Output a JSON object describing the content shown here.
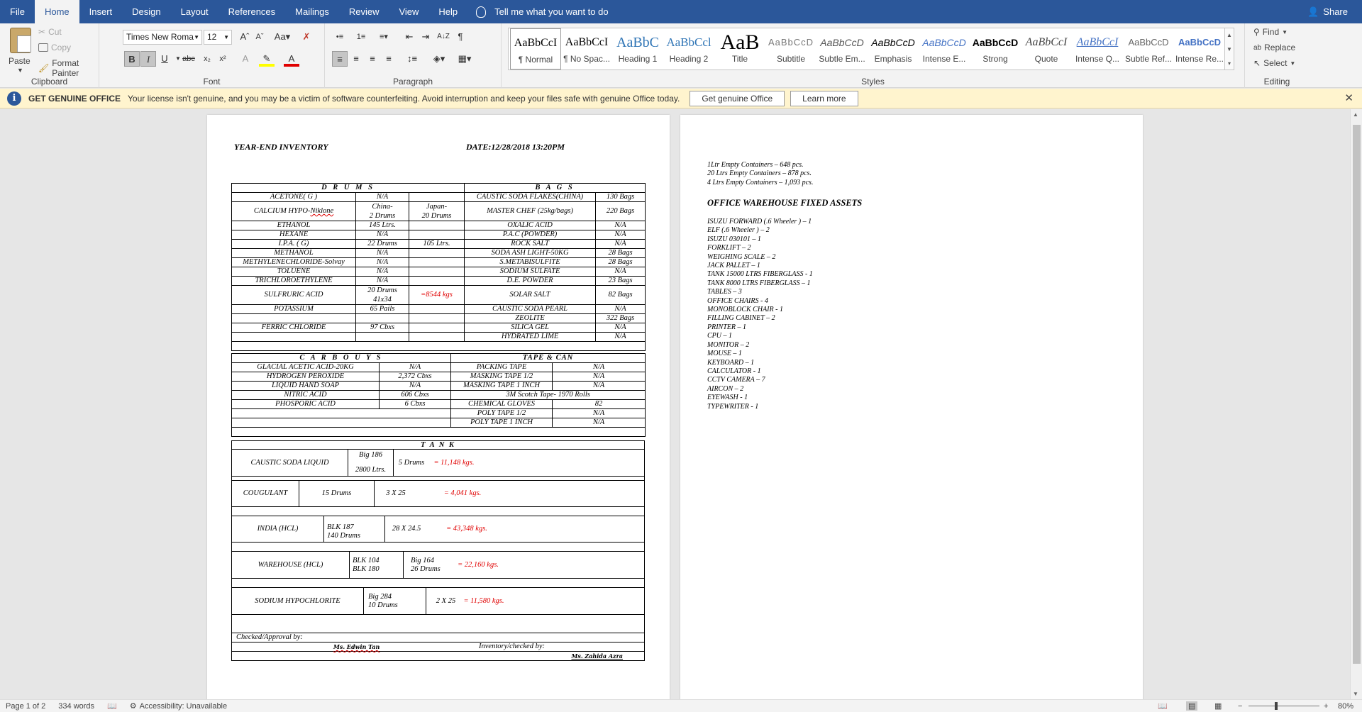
{
  "ribbon_tabs": [
    "File",
    "Home",
    "Insert",
    "Design",
    "Layout",
    "References",
    "Mailings",
    "Review",
    "View",
    "Help"
  ],
  "tell_me": "Tell me what you want to do",
  "share": "Share",
  "clipboard": {
    "paste": "Paste",
    "cut": "Cut",
    "copy": "Copy",
    "format_painter": "Format Painter",
    "label": "Clipboard"
  },
  "font": {
    "name": "Times New Roma",
    "size": "12",
    "label": "Font"
  },
  "paragraph": {
    "label": "Paragraph"
  },
  "styles": {
    "label": "Styles",
    "items": [
      {
        "sample": "AaBbCcI",
        "name": "¶ Normal"
      },
      {
        "sample": "AaBbCcI",
        "name": "¶ No Spac..."
      },
      {
        "sample": "AaBbC",
        "name": "Heading 1"
      },
      {
        "sample": "AaBbCcl",
        "name": "Heading 2"
      },
      {
        "sample": "AaB",
        "name": "Title"
      },
      {
        "sample": "AaBbCcD",
        "name": "Subtitle"
      },
      {
        "sample": "AaBbCcD",
        "name": "Subtle Em..."
      },
      {
        "sample": "AaBbCcD",
        "name": "Emphasis"
      },
      {
        "sample": "AaBbCcD",
        "name": "Intense E..."
      },
      {
        "sample": "AaBbCcD",
        "name": "Strong"
      },
      {
        "sample": "AaBbCcI",
        "name": "Quote"
      },
      {
        "sample": "AaBbCcI",
        "name": "Intense Q..."
      },
      {
        "sample": "AaBbCcD",
        "name": "Subtle Ref..."
      },
      {
        "sample": "AaBbCcD",
        "name": "Intense Re..."
      }
    ]
  },
  "editing": {
    "find": "Find",
    "replace": "Replace",
    "select": "Select",
    "label": "Editing"
  },
  "message_bar": {
    "title": "GET GENUINE OFFICE",
    "text": "Your license isn't genuine, and you may be a victim of software counterfeiting. Avoid interruption and keep your files safe with genuine Office today.",
    "btn1": "Get genuine Office",
    "btn2": "Learn more"
  },
  "doc": {
    "title": "YEAR-END INVENTORY",
    "date": "DATE:12/28/2018 13:20PM",
    "drums_header": "D R U M S",
    "bags_header": "B A G S",
    "drums_rows": [
      [
        "ACETONE( G )",
        "N/A",
        ""
      ],
      [
        "CALCIUM HYPO-Niklone",
        "China-\n2 Drums",
        "Japan-\n20 Drums"
      ],
      [
        "ETHANOL",
        "145 Ltrs.",
        ""
      ],
      [
        "HEXANE",
        "N/A",
        ""
      ],
      [
        "I.P.A. ( G)",
        "22 Drums",
        "105 Ltrs."
      ],
      [
        "METHANOL",
        "N/A",
        ""
      ],
      [
        "METHYLENECHLORIDE-Solvay",
        "N/A",
        ""
      ],
      [
        "TOLUENE",
        "N/A",
        ""
      ],
      [
        "TRICHLOROETHYLENE",
        "N/A",
        ""
      ],
      [
        "SULFRURIC ACID",
        "20 Drums\n41x34",
        "=8544 kgs"
      ],
      [
        "POTASSIUM",
        "65 Pails",
        ""
      ],
      [
        "",
        "",
        ""
      ],
      [
        "FERRIC CHLORIDE",
        "97 Cbxs",
        ""
      ],
      [
        "",
        "",
        ""
      ]
    ],
    "bags_rows": [
      [
        "CAUSTIC SODA FLAKES(CHINA)",
        "130  Bags"
      ],
      [
        "MASTER CHEF (25kg/bags)",
        "220 Bags"
      ],
      [
        "OXALIC ACID",
        "N/A"
      ],
      [
        "P.A.C (POWDER)",
        "N/A"
      ],
      [
        "ROCK SALT",
        "N/A"
      ],
      [
        "SODA ASH LIGHT-50KG",
        "28 Bags"
      ],
      [
        "S.METABISULFITE",
        "28 Bags"
      ],
      [
        "SODIUM SULFATE",
        "N/A"
      ],
      [
        "D.E. POWDER",
        "23 Bags"
      ],
      [
        "SOLAR SALT",
        "82 Bags"
      ],
      [
        "CAUSTIC SODA PEARL",
        "N/A"
      ],
      [
        "ZEOLITE",
        "322 Bags"
      ],
      [
        "SILICA GEL",
        "N/A"
      ],
      [
        "HYDRATED LIME",
        "N/A"
      ]
    ],
    "carbouys_header": "C A R B O U Y S",
    "tape_header": "TAPE  &  CAN",
    "carbouys_rows": [
      [
        "GLACIAL ACETIC ACID-20KG",
        "N/A"
      ],
      [
        "HYDROGEN PEROXIDE",
        "2,372 Cbxs"
      ],
      [
        "LIQUID HAND SOAP",
        "N/A"
      ],
      [
        "NITRIC ACID",
        "606 Cbxs"
      ],
      [
        "PHOSPORIC ACID",
        "6 Cbxs"
      ],
      [
        "",
        ""
      ],
      [
        "",
        ""
      ]
    ],
    "tape_rows": [
      [
        "PACKING TAPE",
        "N/A"
      ],
      [
        "MASKING TAPE 1/2",
        "N/A"
      ],
      [
        "MASKING TAPE 1 INCH",
        "N/A"
      ],
      [
        "3M Scotch Tape- 1970 Rolls",
        ""
      ],
      [
        "CHEMICAL GLOVES",
        "82"
      ],
      [
        "POLY TAPE 1/2",
        "N/A"
      ],
      [
        "POLY TAPE 1 INCH",
        "N/A"
      ]
    ],
    "tank_header": "T  A  N  K",
    "tank": {
      "caustic": {
        "name": "CAUSTIC SODA LIQUID",
        "a1": "Big 186",
        "a2": "2800 Ltrs.",
        "b": "5 Drums",
        "total": "= 11,148 kgs."
      },
      "cougulant": {
        "name": "COUGULANT",
        "a": "15 Drums",
        "b": "3 X 25",
        "total": "= 4,041 kgs."
      },
      "india": {
        "name": "INDIA (HCL)",
        "a1": "BLK  187",
        "a2": "140 Drums",
        "b": "28 X 24.5",
        "total": "= 43,348 kgs."
      },
      "warehouse": {
        "name": "WAREHOUSE (HCL)",
        "a1": "BLK 104",
        "a2": "BLK 180",
        "b1": "Big 164",
        "b2": "26 Drums",
        "total": "= 22,160 kgs."
      },
      "sodium": {
        "name": "SODIUM HYPOCHLORITE",
        "a1": "Big 284",
        "a2": "10 Drums",
        "b": "2 X 25",
        "total": "= 11,580 kgs."
      }
    },
    "checked": "Checked/Approval by:",
    "signer1": "Ms. Edwin Tan",
    "inventory_checked": "Inventory/checked   by:",
    "signer2": "Ms. Zahida Azra",
    "page2_lines": [
      "1Ltr Empty Containers – 648 pcs.",
      "20 Ltrs Empty Containers – 878 pcs.",
      "4 Ltrs Empty Containers – 1,093 pcs."
    ],
    "fixed_assets_title": "OFFICE WAREHOUSE FIXED ASSETS",
    "assets": [
      "ISUZU FORWARD (.6 Wheeler ) – 1",
      "ELF (.6 Wheeler ) – 2",
      "ISUZU 030101 – 1",
      "FORKLIFT – 2",
      "WEIGHING SCALE – 2",
      "JACK PALLET – 1",
      "TANK 15000 LTRS FIBERGLASS - 1",
      "TANK 8000 LTRS FIBERGLASS – 1",
      "TABLES – 3",
      "OFFICE CHAIRS - 4",
      "MONOBLOCK CHAIR - 1",
      "FILLING CABINET – 2",
      "PRINTER – 1",
      "CPU – 1",
      "MONITOR – 2",
      "MOUSE – 1",
      "KEYBOARD – 1",
      "CALCULATOR - 1",
      "CCTV CAMERA – 7",
      "AIRCON – 2",
      "EYEWASH - 1",
      "TYPEWRITER - 1"
    ]
  },
  "status": {
    "page": "Page 1 of 2",
    "words": "334 words",
    "accessibility": "Accessibility: Unavailable",
    "zoom": "80%"
  }
}
